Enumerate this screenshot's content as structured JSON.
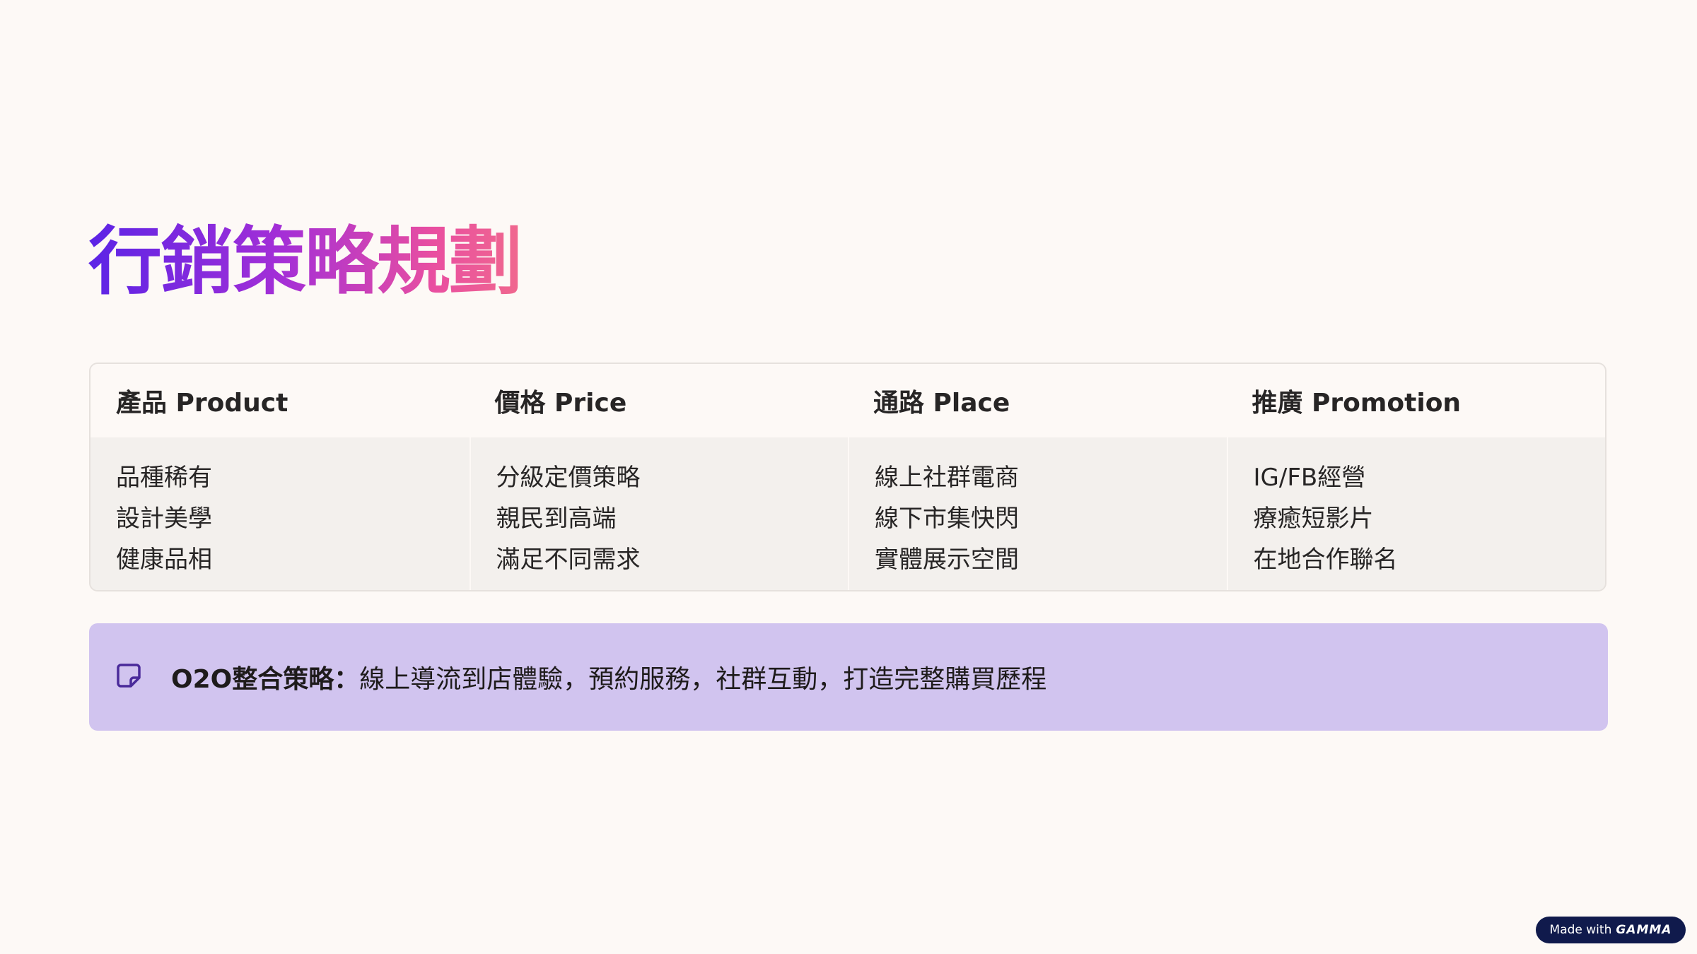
{
  "title": "行銷策略規劃",
  "table": {
    "headers": [
      "產品 Product",
      "價格 Price",
      "通路 Place",
      "推廣 Promotion"
    ],
    "columns": [
      [
        "品種稀有",
        "設計美學",
        "健康品相"
      ],
      [
        "分級定價策略",
        "親民到高端",
        "滿足不同需求"
      ],
      [
        "線上社群電商",
        "線下市集快閃",
        "實體展示空間"
      ],
      [
        "IG/FB經營",
        "療癒短影片",
        "在地合作聯名"
      ]
    ]
  },
  "callout": {
    "icon": "sticky-note-icon",
    "label": "O2O整合策略：",
    "text": "線上導流到店體驗，預約服務，社群互動，打造完整購買歷程",
    "background": "#d1c4ef"
  },
  "badge": {
    "prefix": "Made with",
    "brand": "GAMMA"
  },
  "colors": {
    "background": "#fdf9f6",
    "title_gradient_start": "#5b24e6",
    "title_gradient_end": "#f0688e",
    "badge_background": "#101a4c"
  }
}
